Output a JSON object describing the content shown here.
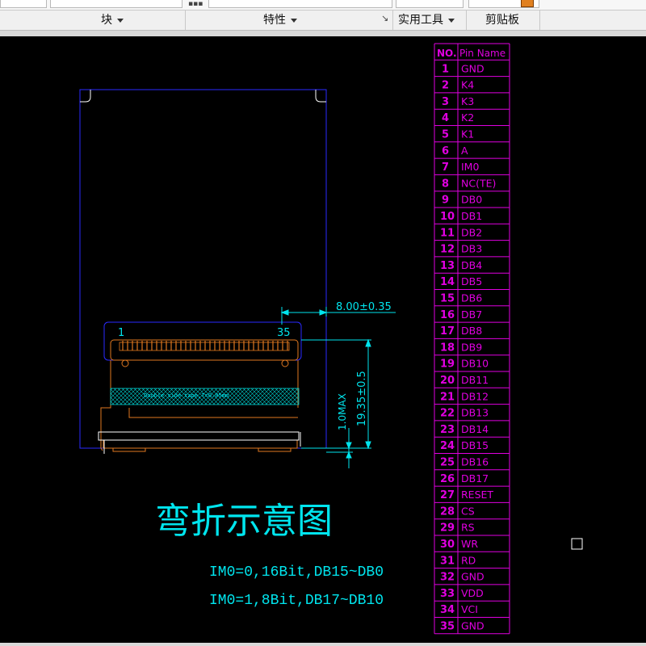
{
  "ribbon": {
    "groups": [
      {
        "label": "块"
      },
      {
        "label": "特性"
      },
      {
        "label": "实用工具"
      },
      {
        "label": "剪贴板"
      }
    ]
  },
  "drawing": {
    "title": "弯折示意图",
    "notes": [
      "IM0=0,16Bit,DB15~DB0",
      "IM0=1,8Bit,DB17~DB10"
    ],
    "dimensions": {
      "fpc_offset": "8.00±0.35",
      "fold_height": "19.35±0.5",
      "max_thickness": "1.0MAX"
    },
    "connector": {
      "first_pin": "1",
      "last_pin": "35"
    },
    "tape_note": "Double side tape,T=0.05mm",
    "colors": {
      "cyan": "#00e5ee",
      "magenta": "#e000e0",
      "blue": "#2a2aff",
      "orange": "#e07820",
      "white": "#ffffff"
    }
  },
  "pin_table": {
    "headers": [
      "NO.",
      "Pin Name"
    ],
    "rows": [
      [
        "1",
        "GND"
      ],
      [
        "2",
        "K4"
      ],
      [
        "3",
        "K3"
      ],
      [
        "4",
        "K2"
      ],
      [
        "5",
        "K1"
      ],
      [
        "6",
        "A"
      ],
      [
        "7",
        "IM0"
      ],
      [
        "8",
        "NC(TE)"
      ],
      [
        "9",
        "DB0"
      ],
      [
        "10",
        "DB1"
      ],
      [
        "11",
        "DB2"
      ],
      [
        "12",
        "DB3"
      ],
      [
        "13",
        "DB4"
      ],
      [
        "14",
        "DB5"
      ],
      [
        "15",
        "DB6"
      ],
      [
        "16",
        "DB7"
      ],
      [
        "17",
        "DB8"
      ],
      [
        "18",
        "DB9"
      ],
      [
        "19",
        "DB10"
      ],
      [
        "20",
        "DB11"
      ],
      [
        "21",
        "DB12"
      ],
      [
        "22",
        "DB13"
      ],
      [
        "23",
        "DB14"
      ],
      [
        "24",
        "DB15"
      ],
      [
        "25",
        "DB16"
      ],
      [
        "26",
        "DB17"
      ],
      [
        "27",
        "RESET"
      ],
      [
        "28",
        "CS"
      ],
      [
        "29",
        "RS"
      ],
      [
        "30",
        "WR"
      ],
      [
        "31",
        "RD"
      ],
      [
        "32",
        "GND"
      ],
      [
        "33",
        "VDD"
      ],
      [
        "34",
        "VCI"
      ],
      [
        "35",
        "GND"
      ]
    ]
  }
}
